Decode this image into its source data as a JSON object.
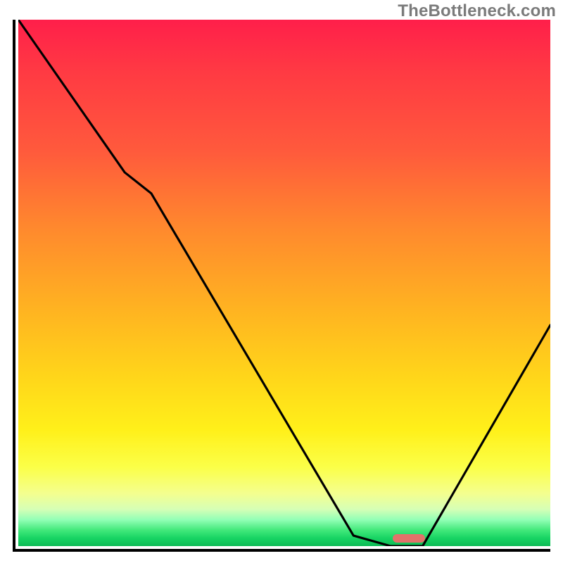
{
  "watermark": "TheBottleneck.com",
  "colors": {
    "axis": "#000000",
    "curve": "#000000",
    "marker": "#e2726a",
    "gradient_top": "#ff1f4a",
    "gradient_bottom": "#0dbb55"
  },
  "chart_data": {
    "type": "line",
    "title": "",
    "xlabel": "",
    "ylabel": "",
    "xlim": [
      0,
      100
    ],
    "ylim": [
      0,
      100
    ],
    "grid": false,
    "legend": false,
    "annotations": [
      {
        "text": "TheBottleneck.com",
        "pos": "top-right"
      }
    ],
    "series": [
      {
        "name": "bottleneck-curve",
        "x": [
          0,
          20,
          25,
          63,
          70,
          76,
          100
        ],
        "values": [
          100,
          71,
          67,
          2,
          0,
          0,
          42
        ]
      }
    ],
    "marker": {
      "x_start": 70,
      "x_end": 76,
      "y": 0.7,
      "color": "#e2726a"
    }
  }
}
